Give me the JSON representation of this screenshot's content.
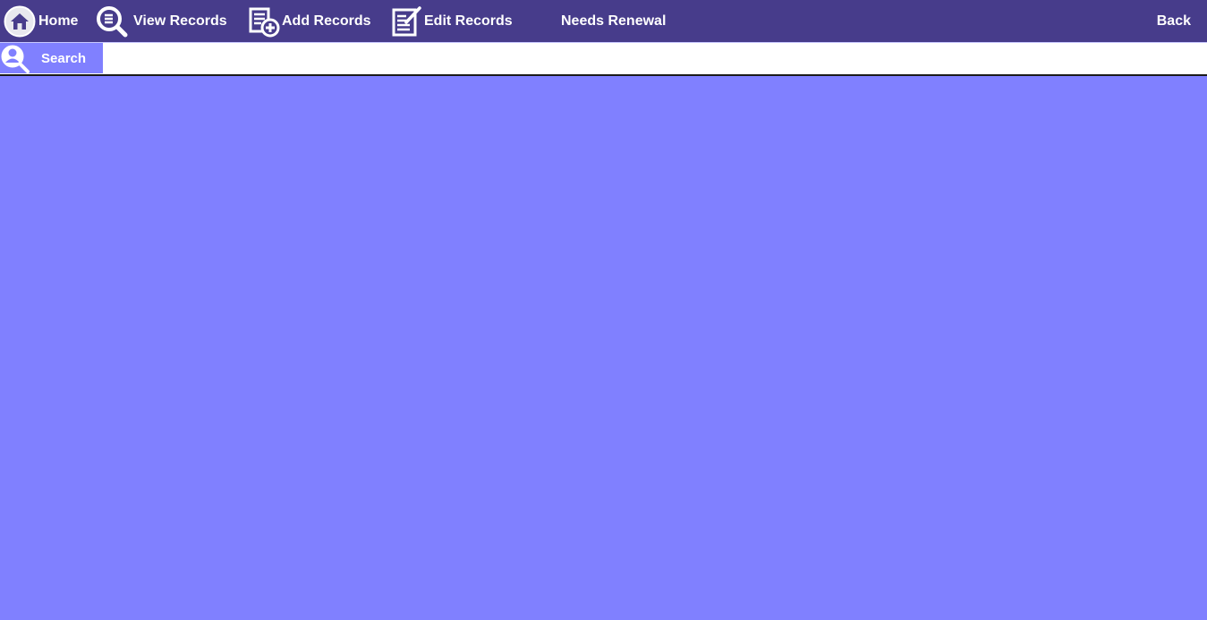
{
  "nav": {
    "home": {
      "label": "Home",
      "icon": "home-icon"
    },
    "view_records": {
      "label": "View Records",
      "icon": "search-records-icon"
    },
    "add_records": {
      "label": "Add Records",
      "icon": "add-document-icon"
    },
    "edit_records": {
      "label": "Edit Records",
      "icon": "edit-document-icon"
    },
    "needs_renewal": {
      "label": "Needs Renewal"
    },
    "back": {
      "label": "Back"
    }
  },
  "search": {
    "button_label": "Search",
    "icon": "user-search-icon",
    "input_value": ""
  },
  "colors": {
    "navbar_bg": "#473c8b",
    "content_bg": "#8080ff",
    "search_button_bg": "#8080ff",
    "text": "#ffffff"
  }
}
